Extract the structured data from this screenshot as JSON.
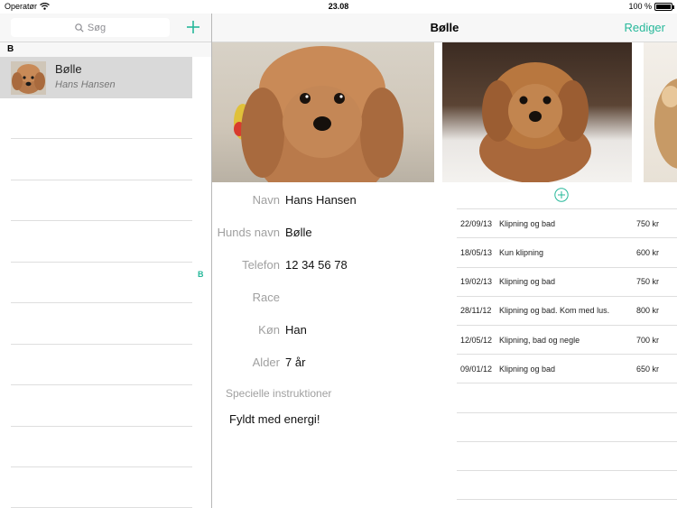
{
  "status_bar": {
    "carrier": "Operatør",
    "time": "23.08",
    "battery": "100 %"
  },
  "sidebar": {
    "search_placeholder": "Søg",
    "section_header": "B",
    "index_letter": "B",
    "contacts": [
      {
        "name": "Bølle",
        "owner": "Hans Hansen"
      }
    ]
  },
  "detail": {
    "title": "Bølle",
    "edit_label": "Rediger",
    "fields": [
      {
        "label": "Navn",
        "value": "Hans Hansen"
      },
      {
        "label": "Hunds navn",
        "value": "Bølle"
      },
      {
        "label": "Telefon",
        "value": "12 34 56 78"
      },
      {
        "label": "Race",
        "value": ""
      },
      {
        "label": "Køn",
        "value": "Han"
      },
      {
        "label": "Alder",
        "value": "7 år"
      }
    ],
    "special_label": "Specielle instruktioner",
    "special_value": "Fyldt med energi!"
  },
  "visits": [
    {
      "date": "22/09/13",
      "desc": "Klipning og bad",
      "price": "750 kr"
    },
    {
      "date": "18/05/13",
      "desc": "Kun klipning",
      "price": "600 kr"
    },
    {
      "date": "19/02/13",
      "desc": "Klipning og bad",
      "price": "750 kr"
    },
    {
      "date": "28/11/12",
      "desc": "Klipning og bad. Kom med lus.",
      "price": "800 kr"
    },
    {
      "date": "12/05/12",
      "desc": "Klipning, bad og negle",
      "price": "700 kr"
    },
    {
      "date": "09/01/12",
      "desc": "Klipning og bad",
      "price": "650 kr"
    }
  ],
  "colors": {
    "accent": "#26b89a",
    "nav_bg": "#f7f7f7",
    "selected_row": "#d9d9d9"
  }
}
